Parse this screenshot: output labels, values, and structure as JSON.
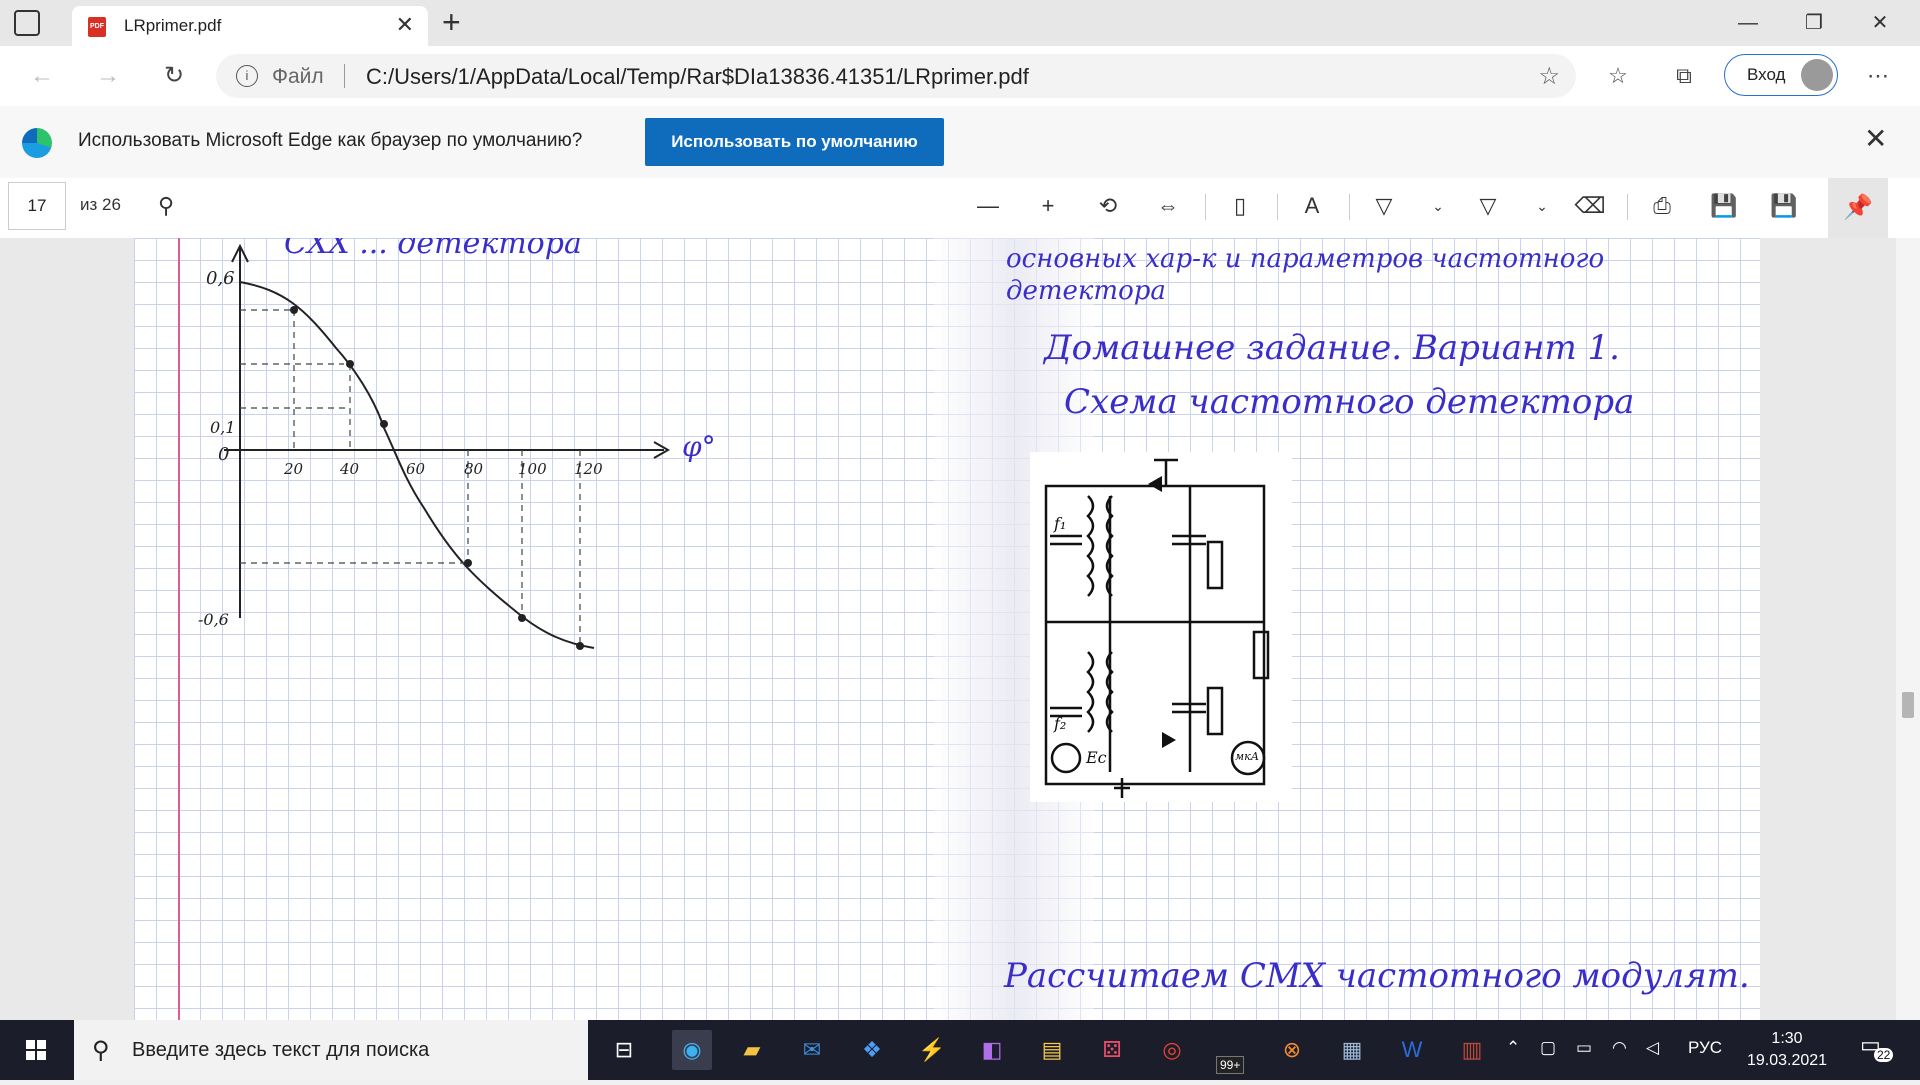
{
  "tab": {
    "title": "LRprimer.pdf",
    "favicon": "PDF"
  },
  "address": {
    "scheme_label": "Файл",
    "url": "C:/Users/1/AppData/Local/Temp/Rar$DIa13836.41351/LRprimer.pdf"
  },
  "account": {
    "login_label": "Вход"
  },
  "infobar": {
    "message": "Использовать Microsoft Edge как браузер по умолчанию?",
    "button_label": "Использовать по умолчанию"
  },
  "pdf": {
    "current_page": "17",
    "page_count": "из 26"
  },
  "notebook": {
    "left": {
      "heading": "СХХ ... детектора",
      "y_top": "0,6",
      "y_mid": "0,1",
      "y_zero": "0",
      "y_bottom": "-0,6",
      "x_ticks": [
        "20",
        "40",
        "60",
        "80",
        "100",
        "120"
      ],
      "x_axis": "φ°"
    },
    "right": {
      "line1": "основных хар-к и параметров частотного",
      "line2": "детектора",
      "line3": "Домашнее задание. Вариант 1.",
      "line4": "Схема частотного детектора",
      "line5": "Рассчитаем СМХ частотного модулят.",
      "circuit": {
        "f1": "f₁",
        "f2": "f₂",
        "ec": "Eс",
        "meter": "мкА"
      }
    }
  },
  "taskbar": {
    "search_placeholder": "Введите здесь текст для поиска",
    "badge_count": "99+",
    "language": "РУС",
    "time": "1:30",
    "date": "19.03.2021",
    "notifications": "22"
  }
}
